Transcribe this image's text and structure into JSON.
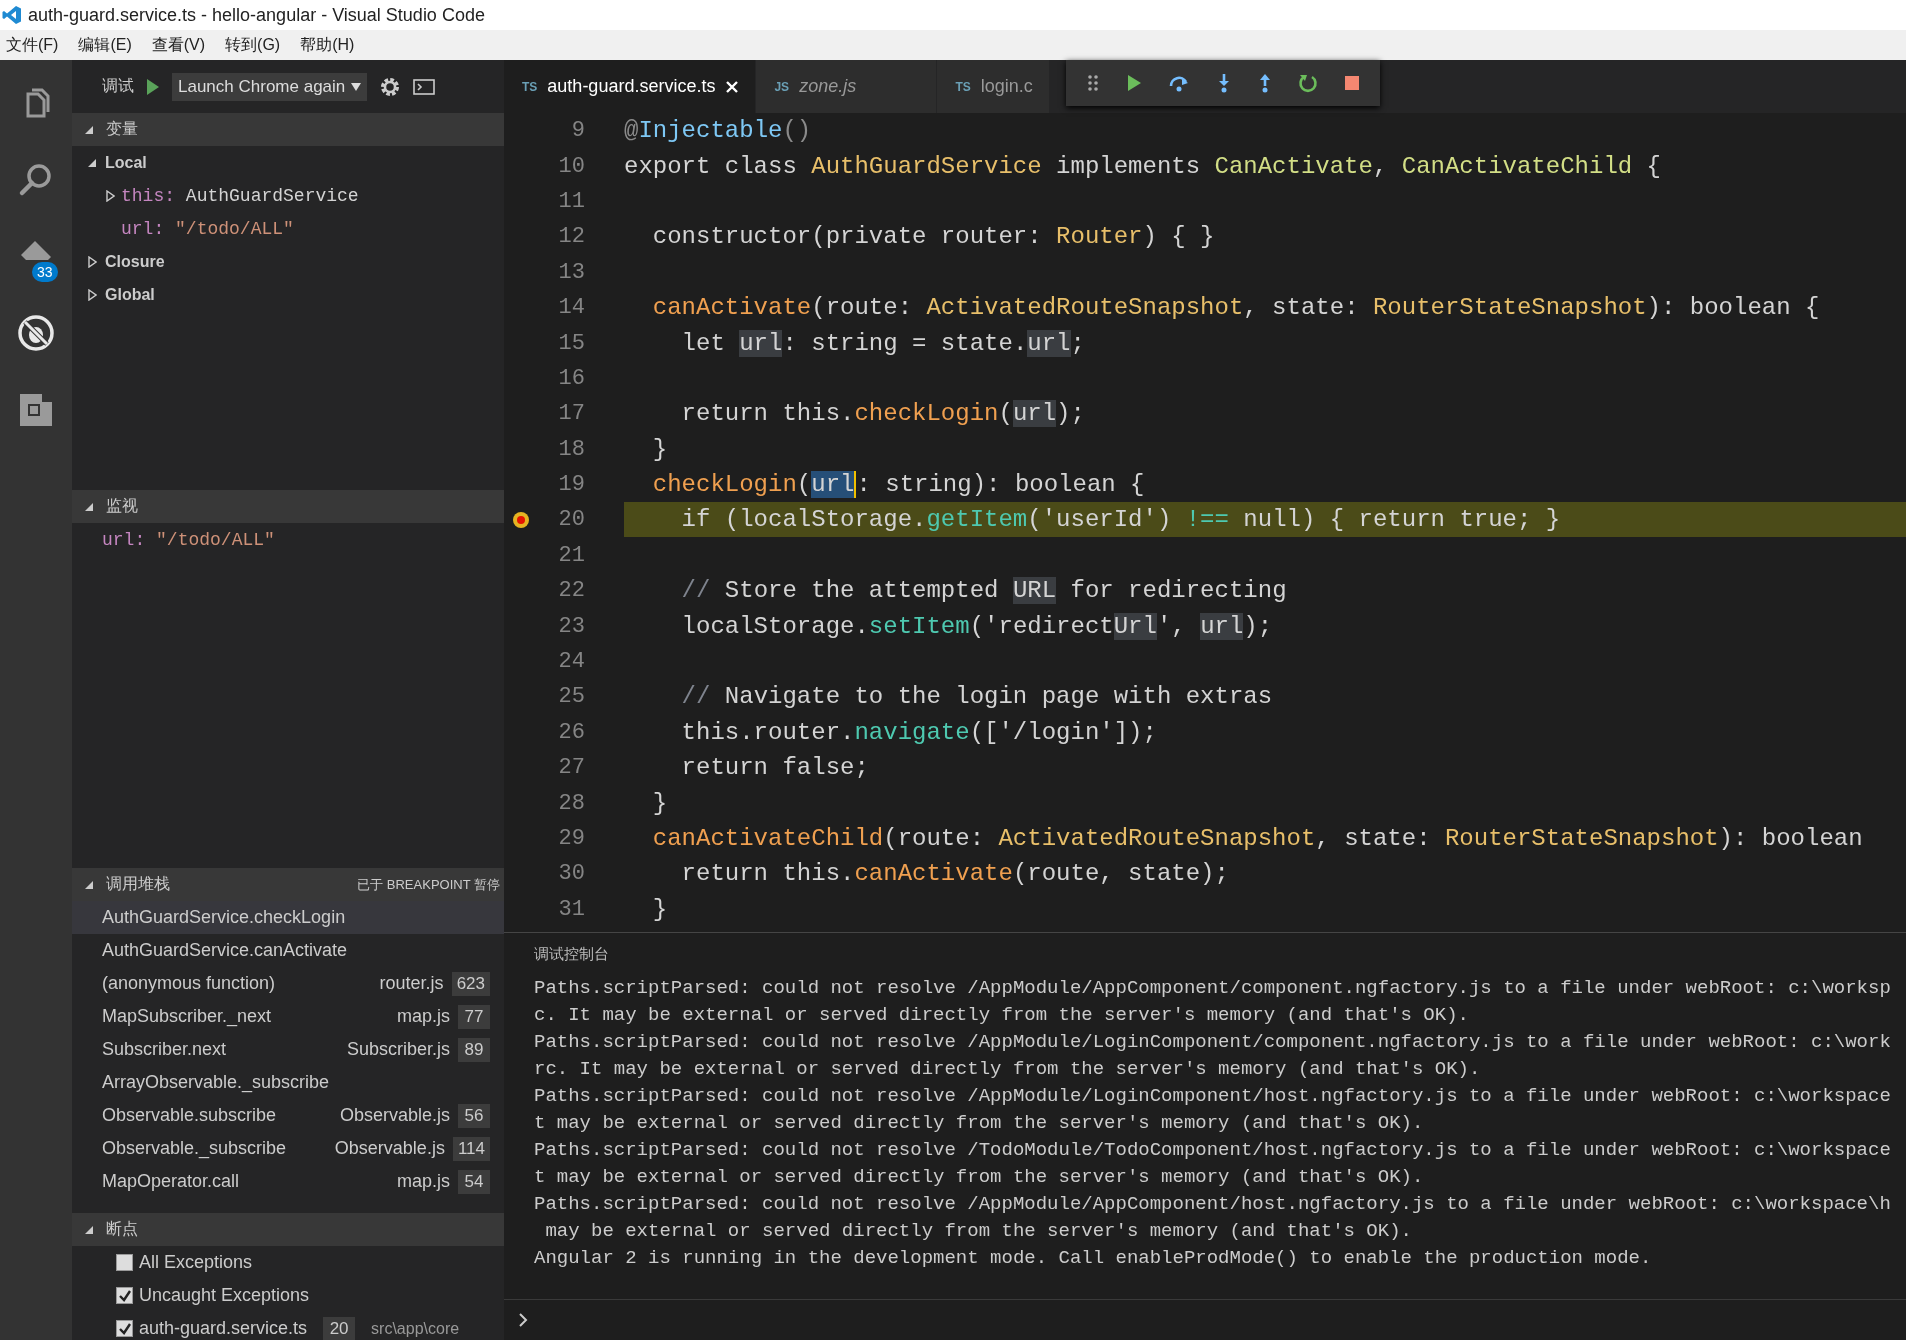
{
  "window": {
    "title": "auth-guard.service.ts - hello-angular - Visual Studio Code"
  },
  "menu": [
    "文件(F)",
    "编辑(E)",
    "查看(V)",
    "转到(G)",
    "帮助(H)"
  ],
  "activity_bar": {
    "badge": "33"
  },
  "debug_header": {
    "label": "调试",
    "configuration": "Launch Chrome again"
  },
  "variables": {
    "title": "变量",
    "expanded": true,
    "scopes": [
      {
        "label": "Local",
        "expanded": true,
        "children": [
          {
            "kind": "object",
            "name": "this:",
            "value": "AuthGuardService",
            "expanded": false
          },
          {
            "kind": "string",
            "name": "url:",
            "value": "\"/todo/ALL\""
          }
        ]
      },
      {
        "label": "Closure",
        "expanded": false
      },
      {
        "label": "Global",
        "expanded": false
      }
    ]
  },
  "watch": {
    "title": "监视",
    "expanded": true,
    "items": [
      {
        "kind": "string",
        "name": "url:",
        "value": "\"/todo/ALL\""
      }
    ]
  },
  "call_stack": {
    "title": "调用堆栈",
    "status": "已于 BREAKPOINT 暂停",
    "expanded": true,
    "frames": [
      {
        "name": "AuthGuardService.checkLogin",
        "selected": true
      },
      {
        "name": "AuthGuardService.canActivate",
        "selected": false
      },
      {
        "name": "(anonymous function)",
        "file": "router.js",
        "line": "623",
        "selected": false
      },
      {
        "name": "MapSubscriber._next",
        "file": "map.js",
        "line": "77",
        "selected": false
      },
      {
        "name": "Subscriber.next",
        "file": "Subscriber.js",
        "line": "89",
        "selected": false
      },
      {
        "name": "ArrayObservable._subscribe",
        "selected": false
      },
      {
        "name": "Observable.subscribe",
        "file": "Observable.js",
        "line": "56",
        "selected": false
      },
      {
        "name": "Observable._subscribe",
        "file": "Observable.js",
        "line": "114",
        "selected": false
      },
      {
        "name": "MapOperator.call",
        "file": "map.js",
        "line": "54",
        "selected": false
      }
    ]
  },
  "breakpoints": {
    "title": "断点",
    "expanded": true,
    "items": [
      {
        "label": "All Exceptions",
        "checked": false
      },
      {
        "label": "Uncaught Exceptions",
        "checked": true
      },
      {
        "label": "auth-guard.service.ts",
        "line": "20",
        "path": "src\\app\\core",
        "checked": true
      }
    ]
  },
  "tabs": [
    {
      "lang": "TS",
      "label": "auth-guard.service.ts",
      "selected": true,
      "preview": false
    },
    {
      "lang": "JS",
      "label": "zone.js",
      "selected": false,
      "preview": true
    },
    {
      "lang": "TS",
      "label": "login.c",
      "selected": false,
      "preview": false
    }
  ],
  "editor": {
    "lines": [
      {
        "number": "9",
        "breakpoint": false,
        "current": false,
        "tokens": [
          {
            "kind": "punct",
            "text": "@"
          },
          {
            "kind": "deco",
            "text": "Injectable"
          },
          {
            "kind": "punct",
            "text": "()"
          }
        ]
      },
      {
        "number": "10",
        "breakpoint": false,
        "current": false,
        "tokens": [
          {
            "kind": "plain",
            "text": "export class "
          },
          {
            "kind": "type",
            "text": "AuthGuardService"
          },
          {
            "kind": "plain",
            "text": " implements "
          },
          {
            "kind": "iface",
            "text": "CanActivate"
          },
          {
            "kind": "plain",
            "text": ", "
          },
          {
            "kind": "iface",
            "text": "CanActivateChild"
          },
          {
            "kind": "plain",
            "text": " {"
          }
        ]
      },
      {
        "number": "11",
        "breakpoint": false,
        "current": false
      },
      {
        "number": "12",
        "breakpoint": false,
        "current": false,
        "tokens": [
          {
            "kind": "plain",
            "text": "  constructor(private router: "
          },
          {
            "kind": "type",
            "text": "Router"
          },
          {
            "kind": "plain",
            "text": ") { }"
          }
        ]
      },
      {
        "number": "13",
        "breakpoint": false,
        "current": false
      },
      {
        "number": "14",
        "breakpoint": false,
        "current": false,
        "tokens": [
          {
            "kind": "func",
            "text": "  canActivate"
          },
          {
            "kind": "plain",
            "text": "(route: "
          },
          {
            "kind": "type",
            "text": "ActivatedRouteSnapshot"
          },
          {
            "kind": "plain",
            "text": ", state: "
          },
          {
            "kind": "type",
            "text": "RouterStateSnapshot"
          },
          {
            "kind": "plain",
            "text": "): boolean {"
          }
        ]
      },
      {
        "number": "15",
        "breakpoint": false,
        "current": false,
        "tokens": [
          {
            "kind": "plain",
            "text": "    let "
          },
          {
            "kind": "ref",
            "text": "url"
          },
          {
            "kind": "plain",
            "text": ": string = state."
          },
          {
            "kind": "ref",
            "text": "url"
          },
          {
            "kind": "plain",
            "text": ";"
          }
        ]
      },
      {
        "number": "16",
        "breakpoint": false,
        "current": false
      },
      {
        "number": "17",
        "breakpoint": false,
        "current": false,
        "tokens": [
          {
            "kind": "plain",
            "text": "    return this."
          },
          {
            "kind": "func",
            "text": "checkLogin"
          },
          {
            "kind": "plain",
            "text": "("
          },
          {
            "kind": "ref",
            "text": "url"
          },
          {
            "kind": "plain",
            "text": ");"
          }
        ]
      },
      {
        "number": "18",
        "breakpoint": false,
        "current": false,
        "tokens": [
          {
            "kind": "plain",
            "text": "  }"
          }
        ]
      },
      {
        "number": "19",
        "breakpoint": false,
        "current": false,
        "tokens": [
          {
            "kind": "func",
            "text": "  checkLogin"
          },
          {
            "kind": "plain",
            "text": "("
          },
          {
            "kind": "sel",
            "text": "url"
          },
          {
            "kind": "plain",
            "text": ": string): boolean {"
          }
        ]
      },
      {
        "number": "20",
        "breakpoint": true,
        "current": true,
        "tokens": [
          {
            "kind": "plain",
            "text": "    if (localStorage."
          },
          {
            "kind": "method",
            "text": "getItem"
          },
          {
            "kind": "plain",
            "text": "('userId') "
          },
          {
            "kind": "method",
            "text": "!=="
          },
          {
            "kind": "plain",
            "text": " null) { return true; }"
          }
        ]
      },
      {
        "number": "21",
        "breakpoint": false,
        "current": false
      },
      {
        "number": "22",
        "breakpoint": false,
        "current": false,
        "tokens": [
          {
            "kind": "comment",
            "text": "    //"
          },
          {
            "kind": "plain",
            "text": " Store the attempted "
          },
          {
            "kind": "ref",
            "text": "URL"
          },
          {
            "kind": "plain",
            "text": " for redirecting"
          }
        ]
      },
      {
        "number": "23",
        "breakpoint": false,
        "current": false,
        "tokens": [
          {
            "kind": "plain",
            "text": "    localStorage."
          },
          {
            "kind": "method",
            "text": "setItem"
          },
          {
            "kind": "plain",
            "text": "('redirect"
          },
          {
            "kind": "ref",
            "text": "Url"
          },
          {
            "kind": "plain",
            "text": "', "
          },
          {
            "kind": "ref",
            "text": "url"
          },
          {
            "kind": "plain",
            "text": ");"
          }
        ]
      },
      {
        "number": "24",
        "breakpoint": false,
        "current": false
      },
      {
        "number": "25",
        "breakpoint": false,
        "current": false,
        "tokens": [
          {
            "kind": "comment",
            "text": "    //"
          },
          {
            "kind": "plain",
            "text": " Navigate to the login page with extras"
          }
        ]
      },
      {
        "number": "26",
        "breakpoint": false,
        "current": false,
        "tokens": [
          {
            "kind": "plain",
            "text": "    this.router."
          },
          {
            "kind": "method",
            "text": "navigate"
          },
          {
            "kind": "plain",
            "text": "(['/login']);"
          }
        ]
      },
      {
        "number": "27",
        "breakpoint": false,
        "current": false,
        "tokens": [
          {
            "kind": "plain",
            "text": "    return false;"
          }
        ]
      },
      {
        "number": "28",
        "breakpoint": false,
        "current": false,
        "tokens": [
          {
            "kind": "plain",
            "text": "  }"
          }
        ]
      },
      {
        "number": "29",
        "breakpoint": false,
        "current": false,
        "tokens": [
          {
            "kind": "func",
            "text": "  canActivateChild"
          },
          {
            "kind": "plain",
            "text": "(route: "
          },
          {
            "kind": "type",
            "text": "ActivatedRouteSnapshot"
          },
          {
            "kind": "plain",
            "text": ", state: "
          },
          {
            "kind": "type",
            "text": "RouterStateSnapshot"
          },
          {
            "kind": "plain",
            "text": "): boolean"
          }
        ]
      },
      {
        "number": "30",
        "breakpoint": false,
        "current": false,
        "tokens": [
          {
            "kind": "plain",
            "text": "    return this."
          },
          {
            "kind": "func",
            "text": "canActivate"
          },
          {
            "kind": "plain",
            "text": "(route, state);"
          }
        ]
      },
      {
        "number": "31",
        "breakpoint": false,
        "current": false,
        "tokens": [
          {
            "kind": "plain",
            "text": "  }"
          }
        ]
      }
    ]
  },
  "debug_console": {
    "title": "调试控制台",
    "lines": [
      "Paths.scriptParsed: could not resolve /AppModule/AppComponent/component.ngfactory.js to a file under webRoot: c:\\worksp",
      "c. It may be external or served directly from the server's memory (and that's OK).",
      "Paths.scriptParsed: could not resolve /AppModule/LoginComponent/component.ngfactory.js to a file under webRoot: c:\\work",
      "rc. It may be external or served directly from the server's memory (and that's OK).",
      "Paths.scriptParsed: could not resolve /AppModule/LoginComponent/host.ngfactory.js to a file under webRoot: c:\\workspace",
      "t may be external or served directly from the server's memory (and that's OK).",
      "Paths.scriptParsed: could not resolve /TodoModule/TodoComponent/host.ngfactory.js to a file under webRoot: c:\\workspace",
      "t may be external or served directly from the server's memory (and that's OK).",
      "Paths.scriptParsed: could not resolve /AppModule/AppComponent/host.ngfactory.js to a file under webRoot: c:\\workspace\\h",
      " may be external or served directly from the server's memory (and that's OK).",
      "Angular 2 is running in the development mode. Call enableProdMode() to enable the production mode."
    ]
  }
}
